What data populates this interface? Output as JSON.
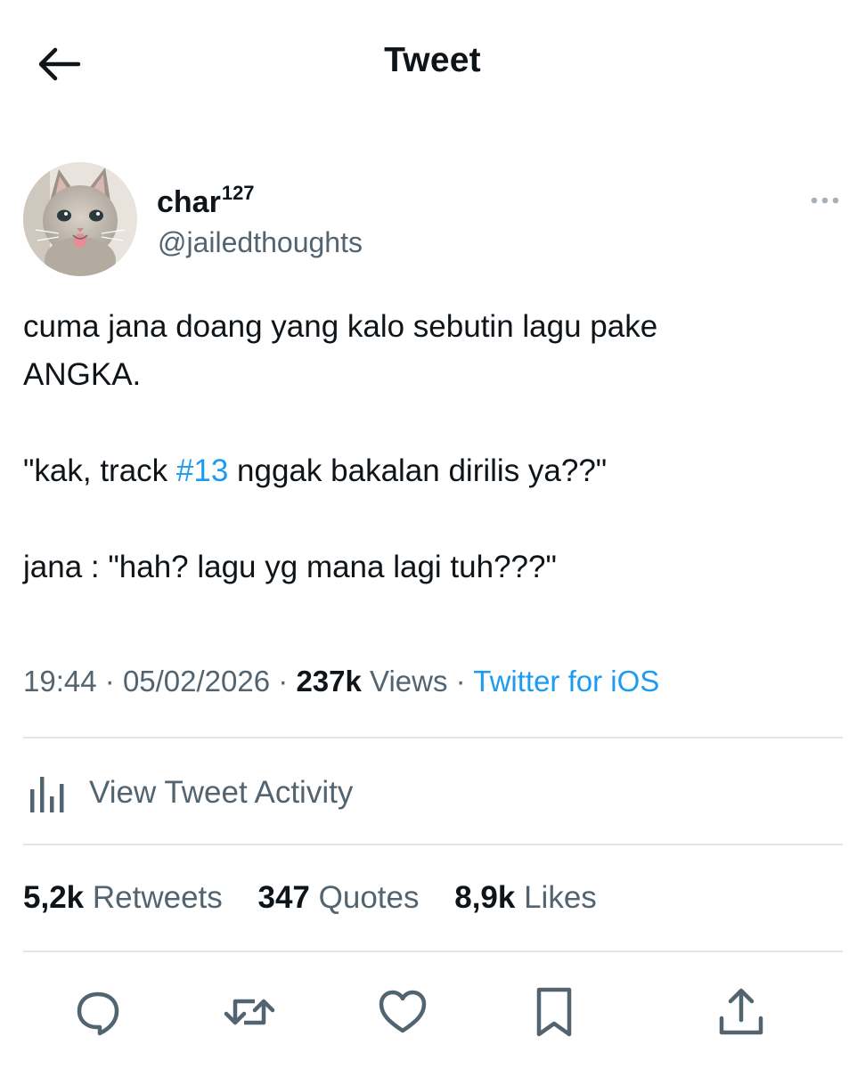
{
  "header": {
    "title": "Tweet",
    "back_icon": "arrow-left-icon"
  },
  "author": {
    "display_name": "char",
    "display_name_sup": "127",
    "handle": "@jailedthoughts",
    "avatar": "kitten-avatar"
  },
  "tweet": {
    "line1": "cuma jana doang yang kalo sebutin lagu pake",
    "line2": "ANGKA.",
    "line3_prefix": "\"kak, track ",
    "line3_hashtag": "#13",
    "line3_suffix": " nggak bakalan dirilis ya??\"",
    "line4": "jana : \"hah? lagu yg mana lagi tuh???\""
  },
  "meta": {
    "time": "19:44",
    "separator": "·",
    "date": "05/02/2026",
    "views_count": "237k",
    "views_label": "Views",
    "source": "Twitter for iOS"
  },
  "activity": {
    "label": "View Tweet Activity",
    "icon": "bar-chart-icon"
  },
  "stats": {
    "retweets_count": "5,2k",
    "retweets_label": "Retweets",
    "quotes_count": "347",
    "quotes_label": "Quotes",
    "likes_count": "8,9k",
    "likes_label": "Likes"
  },
  "colors": {
    "text": "#0f1419",
    "secondary": "#536471",
    "accent": "#1d9bf0",
    "divider": "#e1e5e8"
  },
  "action_icons": [
    "reply-icon",
    "retweet-icon",
    "like-icon",
    "bookmark-icon",
    "share-icon"
  ]
}
